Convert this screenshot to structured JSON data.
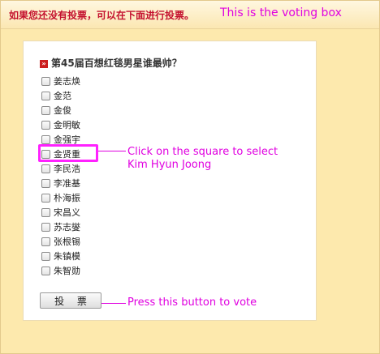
{
  "header": {
    "notice": "如果您还没有投票，可以在下面进行投票。",
    "note": "This is the voting box"
  },
  "poll": {
    "question": "第45届百想红毯男星谁最帅？",
    "options": [
      "姜志焕",
      "金范",
      "金俊",
      "金明敏",
      "金强宇",
      "金贤重",
      "李民浩",
      "李准基",
      "朴海振",
      "宋昌义",
      "苏志燮",
      "张根锡",
      "朱镇模",
      "朱智勋"
    ],
    "vote_label": "投 票"
  },
  "annotations": {
    "checkbox_hint_line1": "Click on the square to select",
    "checkbox_hint_line2": "Kim Hyun Joong",
    "button_hint": "Press this button to vote"
  },
  "colors": {
    "annotation": "#e000e0",
    "notice": "#c4122f",
    "background": "#fde9ad"
  }
}
